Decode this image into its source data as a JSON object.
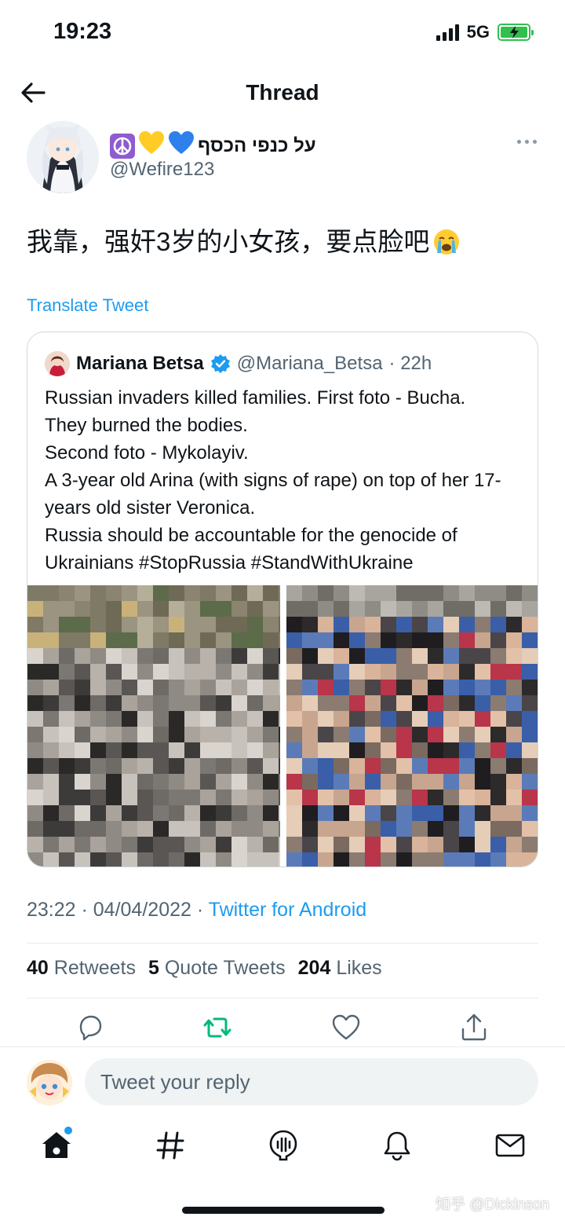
{
  "status_bar": {
    "time": "19:23",
    "network": "5G"
  },
  "nav": {
    "title": "Thread"
  },
  "tweet": {
    "display_name": "על כנפי הכסף",
    "handle": "@Wefire123",
    "text": "我靠，强奸3岁的小女孩，要点脸吧",
    "translate_label": "Translate Tweet",
    "timestamp": "23:22 · 04/04/2022 · ",
    "source": "Twitter for Android",
    "retweets_count": "40",
    "retweets_label": "Retweets",
    "quotes_count": "5",
    "quotes_label": "Quote Tweets",
    "likes_count": "204",
    "likes_label": "Likes"
  },
  "quote": {
    "name": "Mariana Betsa",
    "handle": "@Mariana_Betsa",
    "time": "· 22h",
    "text": "Russian invaders killed families. First foto - Bucha.\nThey burned the bodies.\nSecond foto - Mykolayiv.\nA 3-year old Arina (with signs of rape) on top of her 17-years old sister Veronica.\nRussia should be accountable for the genocide of Ukrainians #StopRussia #StandWithUkraine"
  },
  "reply": {
    "placeholder": "Tweet your reply"
  },
  "watermark": "知乎 @Dickinson",
  "icons": [
    "back-arrow-icon",
    "more-icon",
    "verified-icon",
    "reply-icon",
    "retweet-icon",
    "like-icon",
    "share-icon",
    "home-icon",
    "explore-hashtag-icon",
    "spaces-icon",
    "notifications-icon",
    "messages-icon"
  ],
  "colors": {
    "accent": "#1d9bf0",
    "retweet_green": "#00ba7c",
    "text": "#0f1419",
    "secondary": "#536471"
  }
}
